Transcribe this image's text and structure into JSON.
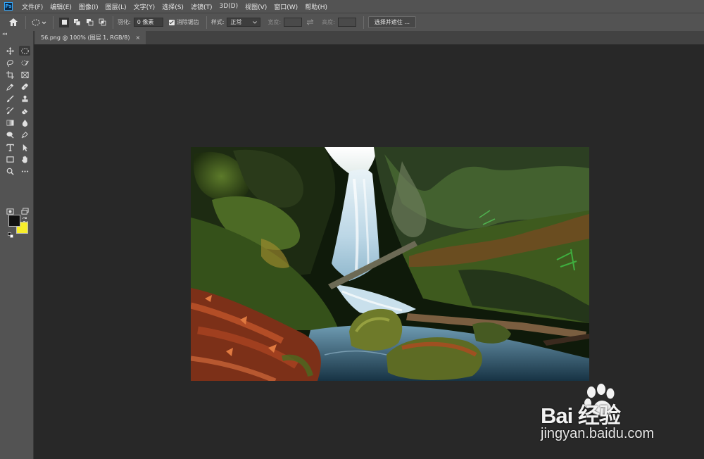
{
  "menubar": {
    "logo": "Ps",
    "items": [
      "文件(F)",
      "编辑(E)",
      "图像(I)",
      "图层(L)",
      "文字(Y)",
      "选择(S)",
      "滤镜(T)",
      "3D(D)",
      "视图(V)",
      "窗口(W)",
      "帮助(H)"
    ]
  },
  "options": {
    "feather_label": "羽化:",
    "feather_value": "0 像素",
    "antialias_label": "消除锯齿",
    "antialias_checked": true,
    "style_label": "样式:",
    "style_value": "正常",
    "width_label": "宽度:",
    "height_label": "高度:",
    "select_mask_button": "选择并遮住 ..."
  },
  "toolbar": {
    "collapse_label": "◂◂",
    "foreground_color": "#111111",
    "background_color": "#f7ee2a"
  },
  "document": {
    "tab_title": "56.png @ 100% (图层 1, RGB/8)",
    "close_label": "×"
  },
  "watermark": {
    "brand": "Bai 经验",
    "url": "jingyan.baidu.com"
  }
}
